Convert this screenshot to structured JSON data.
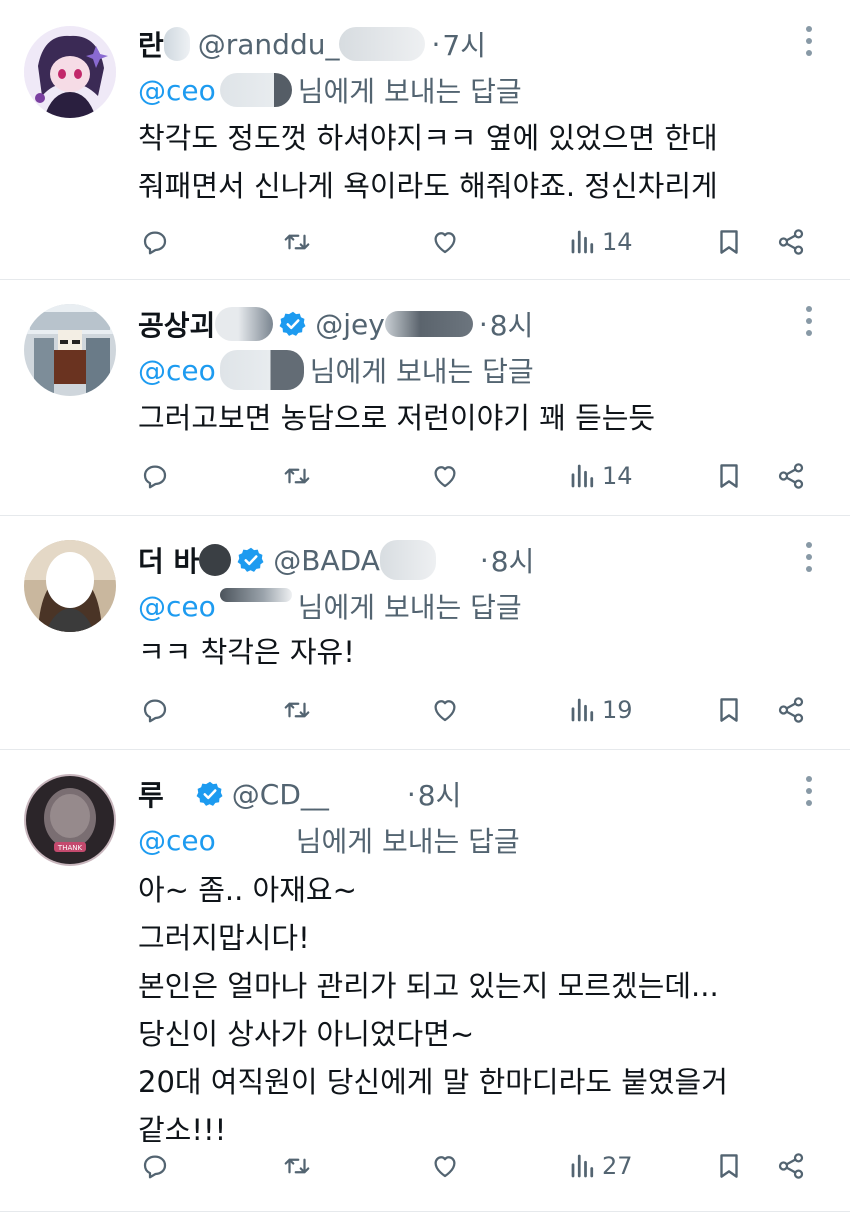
{
  "tweets": [
    {
      "name": "란",
      "verified": false,
      "handle": "@randdu_",
      "dot": "·",
      "time": "7시",
      "mention": "@ceo",
      "reply_text": "님에게 보내는 답글",
      "lines": [
        "착각도 정도껏 하셔야지ㅋㅋ 옆에 있었으면 한대",
        "줘패면서 신나게 욕이라도 해줘야죠. 정신차리게"
      ],
      "views": "14"
    },
    {
      "name": "공상괴",
      "verified": true,
      "handle": "@jey",
      "dot": "·",
      "time": "8시",
      "mention": "@ceo",
      "reply_text": "님에게 보내는 답글",
      "lines": [
        "그러고보면 농담으로 저런이야기 꽤 듣는듯"
      ],
      "views": "14"
    },
    {
      "name": "더 바",
      "verified": true,
      "handle": "@BADA",
      "dot": "·",
      "time": "8시",
      "mention": "@ceo",
      "reply_text": "님에게 보내는 답글",
      "lines": [
        "ㅋㅋ 착각은 자유!"
      ],
      "views": "19"
    },
    {
      "name": "루",
      "verified": true,
      "handle": "@CD__",
      "dot": "·",
      "time": "8시",
      "mention": "@ceo",
      "reply_text": "님에게 보내는 답글",
      "lines": [
        "아~ 좀.. 아재요~",
        "그러지맙시다!",
        "본인은 얼마나 관리가 되고 있는지 모르겠는데...",
        "당신이 상사가 아니었다면~",
        "20대 여직원이 당신에게 말 한마디라도 붙였을거",
        "같소!!!"
      ],
      "views": "27"
    }
  ],
  "icons": {
    "reply": "reply-icon",
    "retweet": "retweet-icon",
    "like": "heart-icon",
    "views": "views-chart-icon",
    "bookmark": "bookmark-icon",
    "share": "share-icon",
    "more": "more-dots-icon",
    "verified": "verified-badge-icon"
  },
  "colors": {
    "text": "#0f1419",
    "secondary": "#536471",
    "accent": "#1d9bf0",
    "divider": "#e6e9ec"
  }
}
